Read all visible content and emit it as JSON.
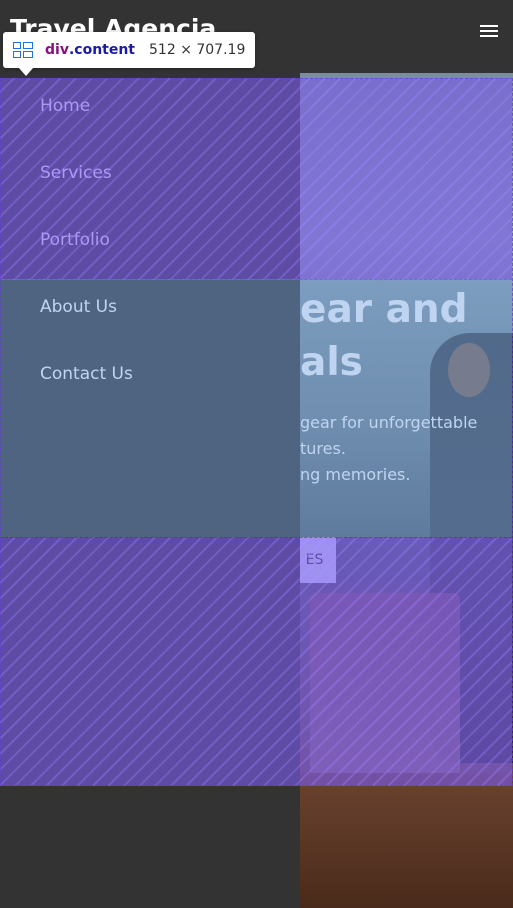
{
  "navbar": {
    "brand": "Travel Agencia",
    "menu_icon": "hamburger-icon"
  },
  "side_menu": {
    "items": [
      {
        "label": "Home"
      },
      {
        "label": "Services"
      },
      {
        "label": "Portfolio"
      },
      {
        "label": "About Us"
      },
      {
        "label": "Contact Us"
      }
    ]
  },
  "hero": {
    "title_line1": "ear and",
    "title_line2": "als",
    "text_line1": "gear for unforgettable",
    "text_line2": "tures.",
    "text_line3": "ng memories.",
    "button_label": "ES"
  },
  "devtools": {
    "element_icon": "grid-layout-icon",
    "tag": "div",
    "class_name": ".content",
    "size": "512 × 707.19"
  },
  "colors": {
    "background": "#333333",
    "overlay_padding": "#7b5ceb",
    "overlay_content": "#6ea0e1",
    "tooltip_tag": "#881280",
    "tooltip_class": "#1a1aa6"
  }
}
